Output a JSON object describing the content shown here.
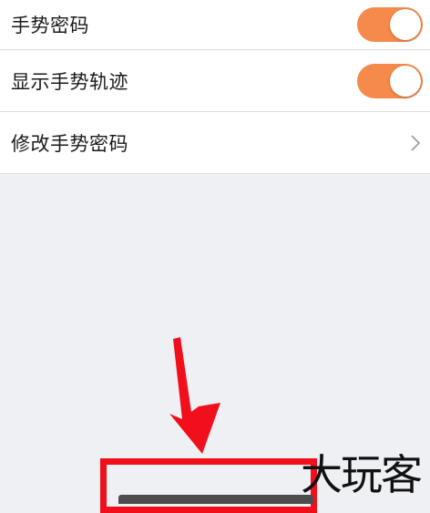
{
  "settings": {
    "rows": [
      {
        "label": "手势密码",
        "control": "toggle",
        "on": true
      },
      {
        "label": "显示手势轨迹",
        "control": "toggle",
        "on": true
      },
      {
        "label": "修改手势密码",
        "control": "chevron"
      }
    ]
  },
  "colors": {
    "toggle_on": "#f68a4a",
    "annotation": "#f20f1c",
    "background": "#eef0f4"
  },
  "annotation": {
    "arrow_icon": "arrow-down-icon"
  },
  "watermark": {
    "text": "大玩客"
  }
}
